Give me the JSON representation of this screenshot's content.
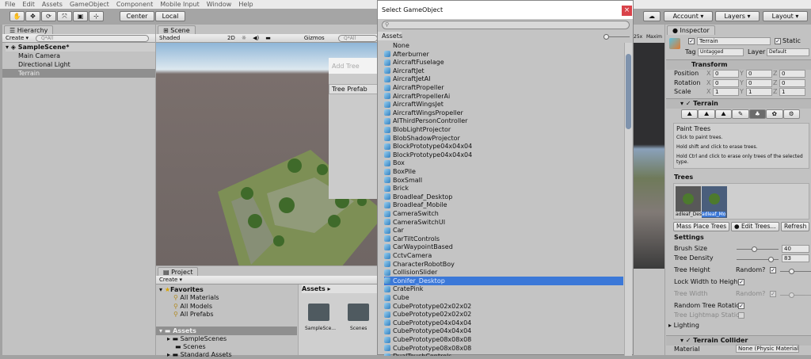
{
  "menu": [
    "File",
    "Edit",
    "Assets",
    "GameObject",
    "Component",
    "Mobile Input",
    "Window",
    "Help"
  ],
  "toolbar": {
    "center": "Center",
    "local": "Local",
    "account": "Account",
    "layers": "Layers",
    "layout": "Layout"
  },
  "hierarchy": {
    "tab": "Hierarchy",
    "create": "Create",
    "search_placeholder": "Q*All",
    "scene": "SampleScene*",
    "items": [
      "Main Camera",
      "Directional Light",
      "Terrain"
    ]
  },
  "scene": {
    "tab": "Scene",
    "shading": "Shaded",
    "mode2d": "2D",
    "gizmos": "Gizmos",
    "search_placeholder": "Q*All",
    "add_tree_title": "Add Tree",
    "tree_prefab_label": "Tree Prefab"
  },
  "game_view": {
    "scale": "25x",
    "maximize": "Maxim"
  },
  "project": {
    "tab": "Project",
    "create": "Create",
    "favorites": "Favorites",
    "fav_items": [
      "All Materials",
      "All Models",
      "All Prefabs"
    ],
    "assets": "Assets",
    "asset_items": [
      "SampleScenes",
      "Scenes",
      "Standard Assets"
    ],
    "breadcrumb": "Assets",
    "folders": [
      "SampleSce...",
      "Scenes"
    ]
  },
  "dialog": {
    "title": "Select GameObject",
    "close": "×",
    "tab": "Assets",
    "selected_index": 28,
    "items": [
      "None",
      "Afterburner",
      "AircraftFuselage",
      "AircraftJet",
      "AircraftJetAI",
      "AircraftPropeller",
      "AircraftPropellerAi",
      "AircraftWingsJet",
      "AircraftWingsPropeller",
      "AIThirdPersonController",
      "BlobLightProjector",
      "BlobShadowProjector",
      "BlockPrototype04x04x04",
      "BlockPrototype04x04x04",
      "Box",
      "BoxPile",
      "BoxSmall",
      "Brick",
      "Broadleaf_Desktop",
      "Broadleaf_Mobile",
      "CameraSwitch",
      "CameraSwitchUI",
      "Car",
      "CarTiltControls",
      "CarWaypointBased",
      "CctvCamera",
      "CharacterRobotBoy",
      "CollisionSlider",
      "Conifer_Desktop",
      "CratePink",
      "Cube",
      "CubePrototype02x02x02",
      "CubePrototype02x02x02",
      "CubePrototype04x04x04",
      "CubePrototype04x04x04",
      "CubePrototype08x08x08",
      "CubePrototype08x08x08",
      "DualTouchControls"
    ]
  },
  "inspector": {
    "tab": "Inspector",
    "name": "Terrain",
    "static": "Static",
    "tag_label": "Tag",
    "tag": "Untagged",
    "layer_label": "Layer",
    "layer": "Default",
    "transform": {
      "title": "Transform",
      "rows": [
        {
          "label": "Position",
          "x": "0",
          "y": "0",
          "z": "0"
        },
        {
          "label": "Rotation",
          "x": "0",
          "y": "0",
          "z": "0"
        },
        {
          "label": "Scale",
          "x": "1",
          "y": "1",
          "z": "1"
        }
      ]
    },
    "terrain": {
      "title": "Terrain",
      "help_title": "Paint Trees",
      "help": [
        "Click to paint trees.",
        "Hold shift and click to erase trees.",
        "Hold Ctrl and click to erase only trees of the selected type."
      ],
      "trees_label": "Trees",
      "trees": [
        "adleaf_Des",
        "adleaf_Mo"
      ],
      "mass_place": "Mass Place Trees",
      "edit_trees": "Edit Trees...",
      "refresh": "Refresh",
      "settings": "Settings",
      "brush_size_label": "Brush Size",
      "brush_size": "40",
      "tree_density_label": "Tree Density",
      "tree_density": "83",
      "tree_height": "Tree Height",
      "random": "Random?",
      "lock_width": "Lock Width to Height",
      "tree_width": "Tree Width",
      "random_rotation": "Random Tree Rotation",
      "lightmap_static": "Tree Lightmap Static",
      "lighting": "Lighting"
    },
    "collider": {
      "title": "Terrain Collider",
      "material_label": "Material",
      "material": "None (Physic Material)"
    }
  }
}
